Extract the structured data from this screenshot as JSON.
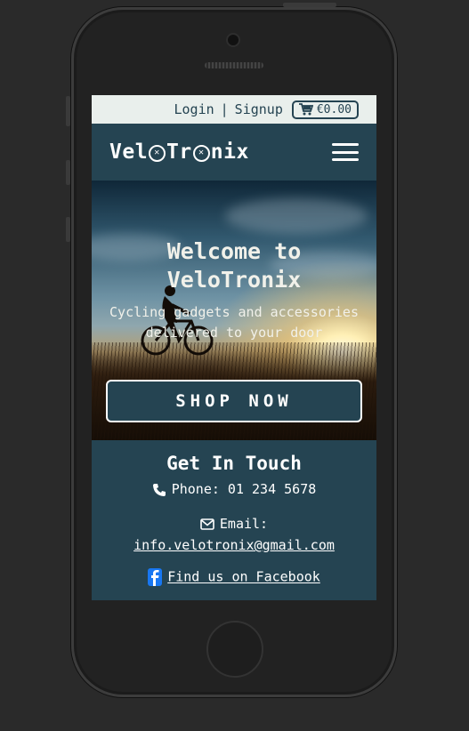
{
  "topbar": {
    "login": "Login",
    "separator": "|",
    "signup": "Signup",
    "cart_total": "€0.00"
  },
  "navbar": {
    "logo_text_parts": [
      "Vel",
      "Tr",
      "nix"
    ]
  },
  "hero": {
    "title_line1": "Welcome to",
    "title_line2": "VeloTronix",
    "subtitle": "Cycling gadgets and accessories delivered to your door",
    "shop_button": "SHOP NOW"
  },
  "contact": {
    "heading": "Get In Touch",
    "phone": "Phone: 01 234 5678",
    "email_label": "Email:",
    "email": "info.velotronix@gmail.com",
    "facebook": "Find us on Facebook"
  },
  "colors": {
    "brand_dark": "#254452",
    "topbar_bg": "#e9efec",
    "facebook_blue": "#1877f2"
  },
  "icons": [
    "cart-icon",
    "menu-icon",
    "phone-icon",
    "envelope-icon",
    "facebook-icon"
  ]
}
